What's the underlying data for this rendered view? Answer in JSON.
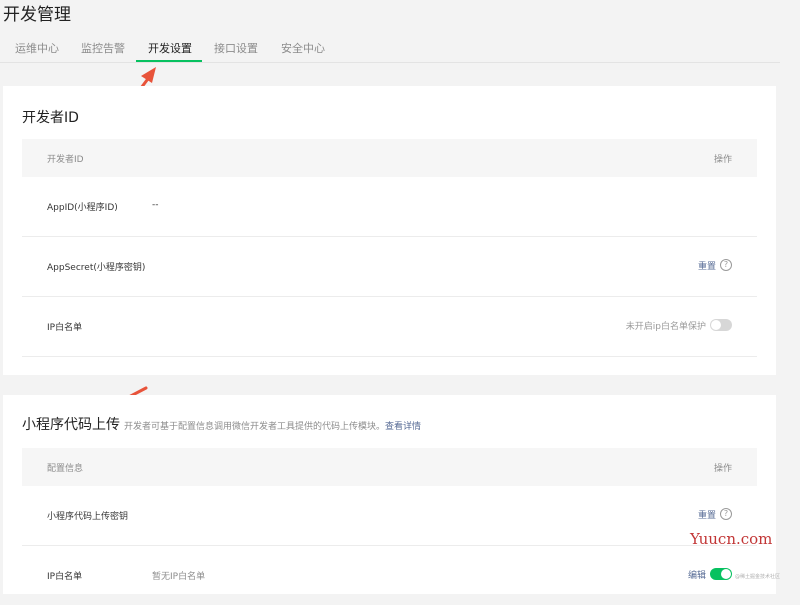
{
  "page": {
    "title": "开发管理"
  },
  "tabs": [
    {
      "label": "运维中心"
    },
    {
      "label": "监控告警"
    },
    {
      "label": "开发设置",
      "active": true
    },
    {
      "label": "接口设置"
    },
    {
      "label": "安全中心"
    }
  ],
  "developer_card": {
    "title": "开发者ID",
    "header_left": "开发者ID",
    "header_right": "操作",
    "rows": [
      {
        "label": "AppID(小程序ID)",
        "value": "--"
      },
      {
        "label": "AppSecret(小程序密钥)",
        "action": "重置",
        "help_icon": "?"
      },
      {
        "label": "IP白名单",
        "status": "未开启ip白名单保护",
        "toggle": false
      }
    ]
  },
  "upload_card": {
    "title": "小程序代码上传",
    "description": "开发者可基于配置信息调用微信开发者工具提供的代码上传模块。",
    "description_link": "查看详情",
    "header_left": "配置信息",
    "header_right": "操作",
    "rows": [
      {
        "label": "小程序代码上传密钥",
        "action": "重置",
        "help_icon": "?"
      },
      {
        "label": "IP白名单",
        "value": "暂无IP白名单",
        "action": "编辑",
        "toggle": true
      }
    ]
  },
  "annotations": {
    "arrow_color": "#e8533a",
    "accent": "#07c160",
    "link_color": "#576b95"
  },
  "watermark": {
    "text": "Yuucn.com",
    "small": "@稀土掘金技术社区"
  }
}
